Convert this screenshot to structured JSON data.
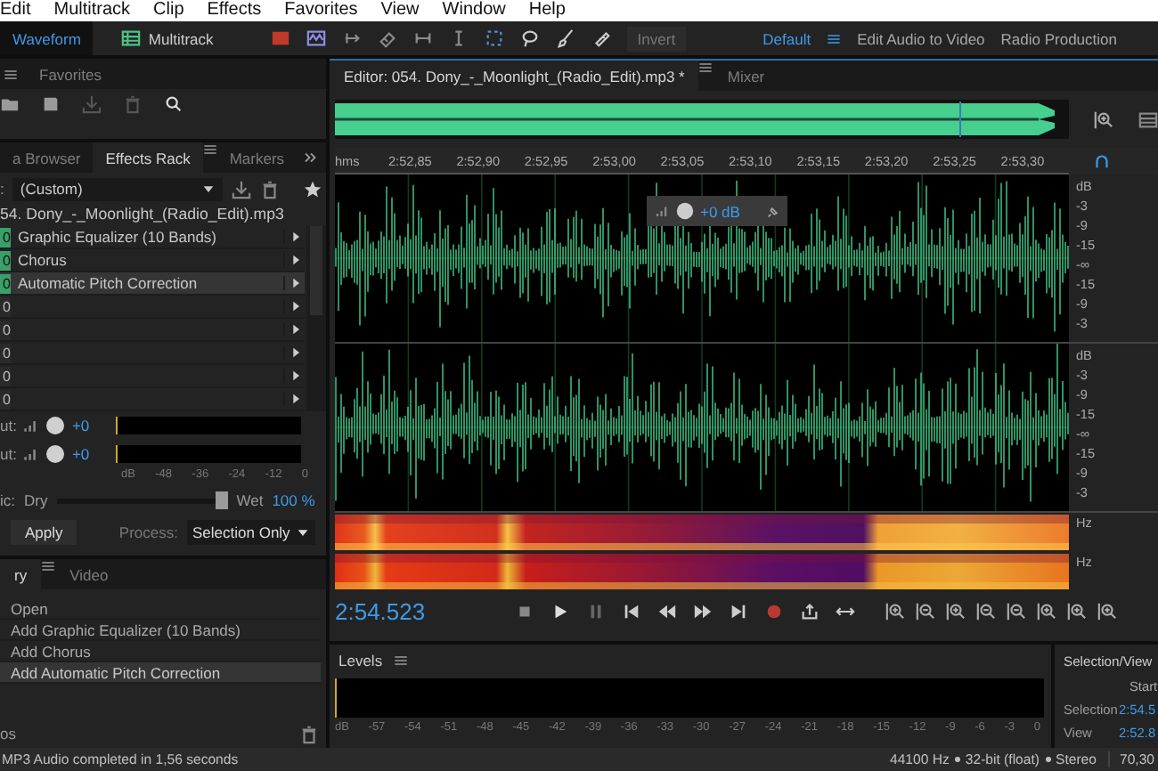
{
  "menu": [
    "Edit",
    "Multitrack",
    "Clip",
    "Effects",
    "Favorites",
    "View",
    "Window",
    "Help"
  ],
  "toolbar": {
    "modes": [
      {
        "label": "Waveform",
        "selected": true
      },
      {
        "label": "Multitrack",
        "selected": false
      }
    ],
    "invert": "Invert",
    "workspaces": [
      {
        "label": "Default",
        "selected": true
      },
      {
        "label": "Edit Audio to Video",
        "selected": false
      },
      {
        "label": "Radio Production",
        "selected": false
      }
    ]
  },
  "favorites": {
    "title": "Favorites"
  },
  "effects_rack": {
    "tabs": [
      {
        "label": "a Browser",
        "selected": false
      },
      {
        "label": "Effects Rack",
        "selected": true
      },
      {
        "label": "Markers",
        "selected": false
      }
    ],
    "preset": {
      "label": ":",
      "value": "(Custom)"
    },
    "file": "54. Dony_-_Moonlight_(Radio_Edit).mp3",
    "slots": [
      {
        "number": "0",
        "name": "Graphic Equalizer (10 Bands)",
        "on": true,
        "selected": false
      },
      {
        "number": "0",
        "name": "Chorus",
        "on": true,
        "selected": false
      },
      {
        "number": "0",
        "name": "Automatic Pitch Correction",
        "on": true,
        "selected": true
      },
      {
        "number": "0",
        "on": false,
        "selected": false
      },
      {
        "number": "0",
        "on": false,
        "selected": false
      },
      {
        "number": "0",
        "on": false,
        "selected": false
      },
      {
        "number": "0",
        "on": false,
        "selected": false
      },
      {
        "number": "0",
        "on": false,
        "selected": false
      }
    ],
    "gains": [
      {
        "label": "ut:",
        "value": "+0"
      },
      {
        "label": "ut:",
        "value": "+0"
      }
    ],
    "meter_scale": [
      "dB",
      "-48",
      "-36",
      "-24",
      "-12",
      "0"
    ],
    "mix": {
      "label": "ic:",
      "dry": "Dry",
      "wet": "Wet",
      "value": "100 %",
      "level": 1.0
    },
    "apply": "Apply",
    "process": {
      "label": "Process:",
      "value": "Selection Only"
    }
  },
  "history": {
    "tabs": [
      {
        "label": "ry",
        "selected": true
      },
      {
        "label": "Video",
        "selected": false
      }
    ],
    "items": [
      {
        "label": "Open",
        "selected": false
      },
      {
        "label": "Add Graphic Equalizer (10 Bands)",
        "selected": false
      },
      {
        "label": "Add Chorus",
        "selected": false
      },
      {
        "label": "Add Automatic Pitch Correction",
        "selected": true
      }
    ],
    "footer": "os"
  },
  "editor": {
    "tabs": [
      {
        "label": "Editor: 054. Dony_-_Moonlight_(Radio_Edit).mp3 *",
        "selected": true
      },
      {
        "label": "Mixer",
        "selected": false
      }
    ],
    "ruler": {
      "unit": "hms",
      "labels": [
        "2:52,85",
        "2:52,90",
        "2:52,95",
        "2:53,00",
        "2:53,05",
        "2:53,10",
        "2:53,15",
        "2:53,20",
        "2:53,25",
        "2:53,30"
      ]
    },
    "hud": "+0 dB",
    "channels": [
      {
        "scale": [
          "dB",
          "-3",
          "-9",
          "-15",
          "-∞",
          "-15",
          "-9",
          "-3"
        ]
      },
      {
        "scale": [
          "dB",
          "-3",
          "-9",
          "-15",
          "-∞",
          "-15",
          "-9",
          "-3"
        ]
      }
    ],
    "spectral": [
      {
        "unit": "Hz"
      },
      {
        "unit": "Hz"
      }
    ],
    "time": "2:54.523"
  },
  "levels": {
    "title": "Levels",
    "scale": [
      "dB",
      "-57",
      "-54",
      "-51",
      "-48",
      "-45",
      "-42",
      "-39",
      "-36",
      "-33",
      "-30",
      "-27",
      "-24",
      "-21",
      "-18",
      "-15",
      "-12",
      "-9",
      "-6",
      "-3",
      "0"
    ]
  },
  "selection_view": {
    "title": "Selection/View",
    "column": "Start",
    "rows": [
      {
        "label": "Selection",
        "start": "2:54.5"
      },
      {
        "label": "View",
        "start": "2:52.8"
      }
    ]
  },
  "status_bar": {
    "message": "MP3 Audio completed in 1,56 seconds",
    "format": [
      "44100 Hz",
      "32-bit (float)",
      "Stereo"
    ],
    "size": "70,30"
  }
}
